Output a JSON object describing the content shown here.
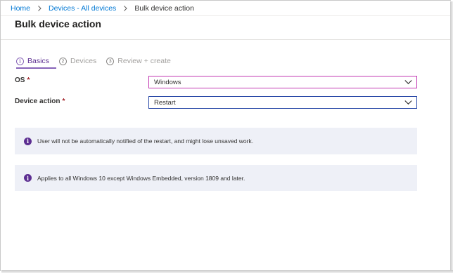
{
  "breadcrumb": {
    "items": [
      "Home",
      "Devices - All devices",
      "Bulk device action"
    ]
  },
  "page": {
    "title": "Bulk device action"
  },
  "wizard": {
    "tabs": [
      {
        "number": "1",
        "label": "Basics",
        "active": true
      },
      {
        "number": "2",
        "label": "Devices",
        "active": false
      },
      {
        "number": "3",
        "label": "Review + create",
        "active": false
      }
    ]
  },
  "form": {
    "os": {
      "label": "OS",
      "required_mark": "*",
      "value": "Windows"
    },
    "device_action": {
      "label": "Device action",
      "required_mark": "*",
      "value": "Restart"
    }
  },
  "info": [
    {
      "icon": "i",
      "icon_name": "info-icon",
      "text": "User will not be automatically notified of the restart, and might lose unsaved work."
    },
    {
      "icon": "i",
      "icon_name": "info-icon",
      "text": "Applies to all Windows 10 except Windows Embedded, version 1809 and later."
    }
  ],
  "colors": {
    "link": "#0078d4",
    "accent": "#8764b8",
    "accent_text": "#5c2e91",
    "required": "#a4262c",
    "info_background": "#eef0f7"
  }
}
